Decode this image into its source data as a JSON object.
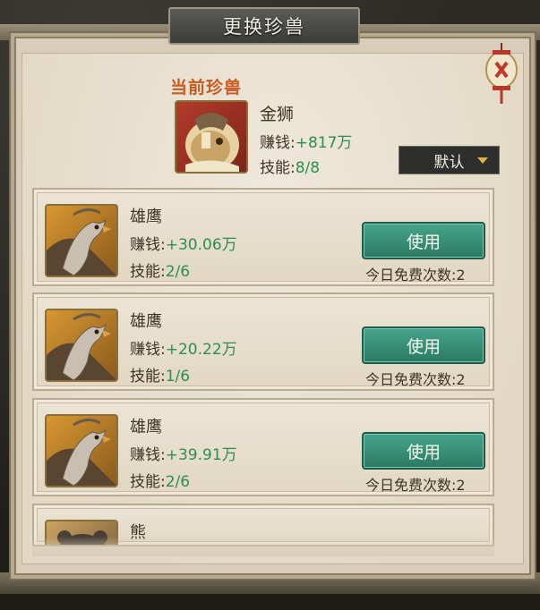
{
  "dialog": {
    "title": "更换珍兽"
  },
  "current": {
    "section_label": "当前珍兽",
    "name": "金狮",
    "earn_label": "赚钱:",
    "earn_value": "+817万",
    "skill_label": "技能:",
    "skill_value": "8/8"
  },
  "sort_dropdown": {
    "selected": "默认"
  },
  "beasts": [
    {
      "name": "雄鹰",
      "earn_label": "赚钱:",
      "earn_value": "+30.06万",
      "skill_label": "技能:",
      "skill_value": "2/6",
      "button": "使用",
      "free_count": "今日免费次数:2"
    },
    {
      "name": "雄鹰",
      "earn_label": "赚钱:",
      "earn_value": "+20.22万",
      "skill_label": "技能:",
      "skill_value": "1/6",
      "button": "使用",
      "free_count": "今日免费次数:2"
    },
    {
      "name": "雄鹰",
      "earn_label": "赚钱:",
      "earn_value": "+39.91万",
      "skill_label": "技能:",
      "skill_value": "2/6",
      "button": "使用",
      "free_count": "今日免费次数:2"
    },
    {
      "name": "熊"
    }
  ],
  "colors": {
    "accent_orange": "#c85a23",
    "earn_green": "#2f8e4e",
    "button_green": "#2b7a64",
    "panel_bg": "#e2d8c4"
  },
  "icons": [
    "lion-portrait",
    "eagle-portrait",
    "bear-portrait",
    "lantern-icon",
    "dropdown-arrow-icon"
  ]
}
